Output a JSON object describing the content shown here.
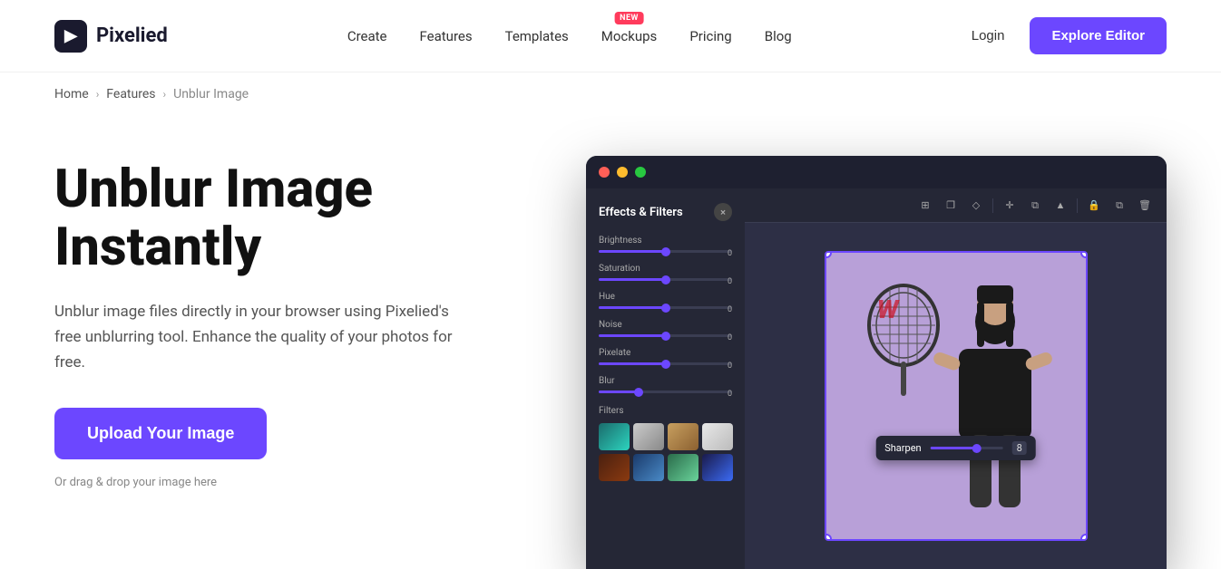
{
  "header": {
    "logo_text": "Pixelied",
    "nav": {
      "create": "Create",
      "features": "Features",
      "templates": "Templates",
      "mockups": "Mockups",
      "new_badge": "NEW",
      "pricing": "Pricing",
      "blog": "Blog",
      "login": "Login",
      "explore_btn": "Explore Editor"
    }
  },
  "breadcrumb": {
    "home": "Home",
    "features": "Features",
    "current": "Unblur Image"
  },
  "hero": {
    "title_line1": "Unblur Image",
    "title_line2": "Instantly",
    "description": "Unblur image files directly in your browser using Pixelied's free unblurring tool. Enhance the quality of your photos for free.",
    "upload_btn": "Upload Your Image",
    "drag_drop": "Or drag & drop your image here"
  },
  "editor": {
    "panel_title": "Effects & Filters",
    "close_label": "×",
    "sliders": [
      {
        "label": "Brightness",
        "value": "0",
        "fill_pct": 50
      },
      {
        "label": "Saturation",
        "value": "0",
        "fill_pct": 50
      },
      {
        "label": "Hue",
        "value": "0",
        "fill_pct": 50
      },
      {
        "label": "Noise",
        "value": "0",
        "fill_pct": 50
      },
      {
        "label": "Pixelate",
        "value": "0",
        "fill_pct": 50
      },
      {
        "label": "Blur",
        "value": "0",
        "fill_pct": 30
      }
    ],
    "filters_label": "Filters",
    "sharpen_label": "Sharpen",
    "sharpen_value": "8"
  },
  "window_controls": {
    "dot_red": "#ff5f57",
    "dot_yellow": "#febc2e",
    "dot_green": "#28c840"
  }
}
